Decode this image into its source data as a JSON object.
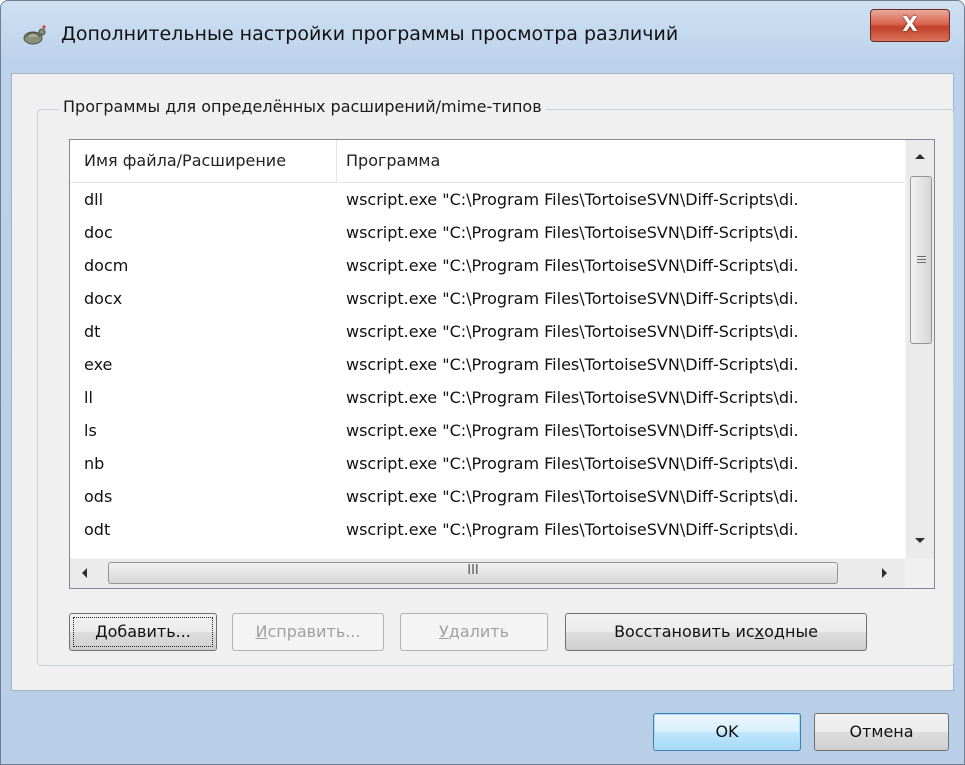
{
  "window": {
    "title": "Дополнительные настройки программы просмотра различий",
    "close_label": "X",
    "app_icon": "tortoise-icon"
  },
  "group": {
    "label": "Программы для определённых расширений/mime-типов"
  },
  "list": {
    "columns": [
      "Имя файла/Расширение",
      "Программа"
    ],
    "rows": [
      {
        "ext": "dll",
        "program": "wscript.exe \"C:\\Program Files\\TortoiseSVN\\Diff-Scripts\\di."
      },
      {
        "ext": "doc",
        "program": "wscript.exe \"C:\\Program Files\\TortoiseSVN\\Diff-Scripts\\di."
      },
      {
        "ext": "docm",
        "program": "wscript.exe \"C:\\Program Files\\TortoiseSVN\\Diff-Scripts\\di."
      },
      {
        "ext": "docx",
        "program": "wscript.exe \"C:\\Program Files\\TortoiseSVN\\Diff-Scripts\\di."
      },
      {
        "ext": "dt",
        "program": "wscript.exe \"C:\\Program Files\\TortoiseSVN\\Diff-Scripts\\di."
      },
      {
        "ext": "exe",
        "program": "wscript.exe \"C:\\Program Files\\TortoiseSVN\\Diff-Scripts\\di."
      },
      {
        "ext": "ll",
        "program": "wscript.exe \"C:\\Program Files\\TortoiseSVN\\Diff-Scripts\\di."
      },
      {
        "ext": "ls",
        "program": "wscript.exe \"C:\\Program Files\\TortoiseSVN\\Diff-Scripts\\di."
      },
      {
        "ext": "nb",
        "program": "wscript.exe \"C:\\Program Files\\TortoiseSVN\\Diff-Scripts\\di."
      },
      {
        "ext": "ods",
        "program": "wscript.exe \"C:\\Program Files\\TortoiseSVN\\Diff-Scripts\\di."
      },
      {
        "ext": "odt",
        "program": "wscript.exe \"C:\\Program Files\\TortoiseSVN\\Diff-Scripts\\di."
      }
    ],
    "hscroll_grip": "III"
  },
  "buttons": {
    "add": {
      "key": "Д",
      "rest": "обавить..."
    },
    "edit": {
      "key": "И",
      "rest": "справить..."
    },
    "delete": {
      "key": "У",
      "rest": "далить"
    },
    "restore": {
      "pre": "Восстановить ис",
      "key": "х",
      "rest": "одные"
    },
    "ok": "OK",
    "cancel": "Отмена"
  },
  "colors": {
    "title_bar": "#bcd2ea",
    "close_button": "#c1402a",
    "client": "#f0f0f0",
    "default_button": "#a7d9f5"
  }
}
